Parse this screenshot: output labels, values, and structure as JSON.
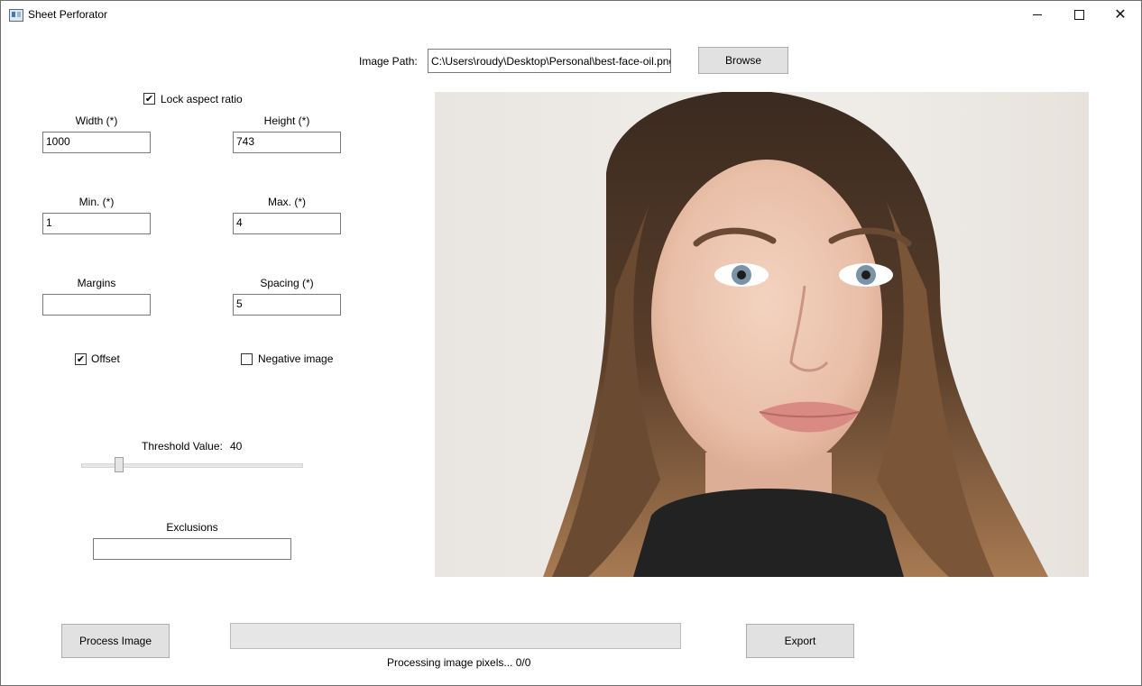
{
  "window": {
    "title": "Sheet Perforator",
    "icon": "app-window-icon",
    "controls": [
      "minimize-icon",
      "maximize-icon",
      "close-icon"
    ]
  },
  "image_path": {
    "label": "Image Path:",
    "value": "C:\\Users\\roudy\\Desktop\\Personal\\best-face-oil.png",
    "browse_label": "Browse"
  },
  "options": {
    "lock_aspect": {
      "label": "Lock aspect ratio",
      "checked": true
    },
    "width": {
      "label": "Width (*)",
      "value": "1000"
    },
    "height": {
      "label": "Height (*)",
      "value": "743"
    },
    "min": {
      "label": "Min. (*)",
      "value": "1"
    },
    "max": {
      "label": "Max. (*)",
      "value": "4"
    },
    "margins": {
      "label": "Margins",
      "value": ""
    },
    "spacing": {
      "label": "Spacing (*)",
      "value": "5"
    },
    "offset": {
      "label": "Offset",
      "checked": true
    },
    "negative": {
      "label": "Negative image",
      "checked": false
    },
    "threshold": {
      "label": "Threshold Value:",
      "value": "40",
      "min": 0,
      "max": 255
    },
    "exclusions": {
      "label": "Exclusions",
      "value": ""
    }
  },
  "preview": {
    "description_icon": "portrait-photo"
  },
  "footer": {
    "process_label": "Process Image",
    "export_label": "Export",
    "status": "Processing image pixels...  0/0",
    "progress": 0
  }
}
